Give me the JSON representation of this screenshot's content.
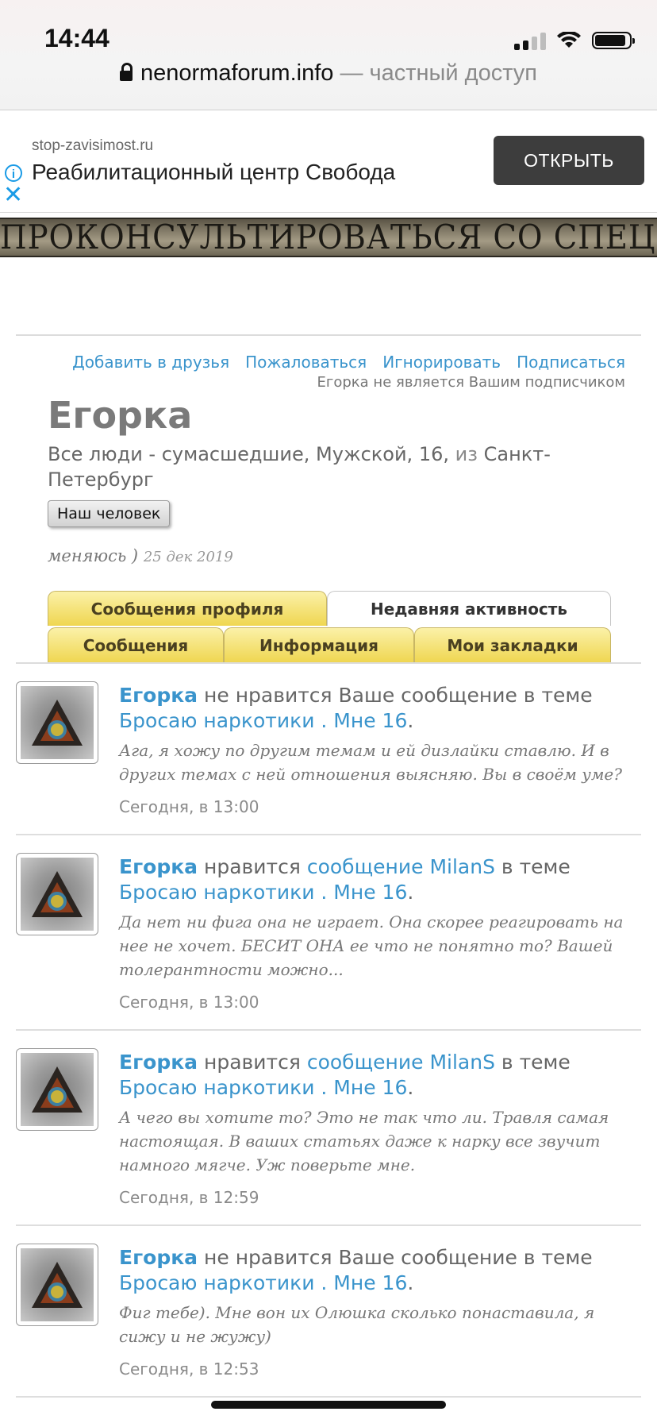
{
  "status_bar": {
    "time": "14:44"
  },
  "browser": {
    "domain": "nenormaforum.info",
    "suffix": "— частный доступ"
  },
  "ad": {
    "domain": "stop-zavisimost.ru",
    "title": "Реабилитационный центр Свобода",
    "button": "ОТКРЫТЬ",
    "info_icon": "i",
    "close_icon": "✕"
  },
  "banner_strip": {
    "text": "ПРОКОНСУЛЬТИРОВАТЬСЯ СО СПЕЦИАЛИСТОМ"
  },
  "profile": {
    "actions": [
      "Добавить в друзья",
      "Пожаловаться",
      "Игнорировать",
      "Подписаться"
    ],
    "subscriber_note": "Егорка не является Вашим подписчиком",
    "name": "Егорка",
    "tagline": "Все люди - сумасшедшие",
    "gender": "Мужской",
    "age": "16",
    "from_word": "из",
    "city": "Санкт-Петербург",
    "rank_badge": "Наш человек",
    "status_text": "меняюсь )",
    "status_date": "25 дек 2019"
  },
  "tabs": {
    "row1": [
      "Сообщения профиля",
      "Недавняя активность"
    ],
    "row2": [
      "Сообщения",
      "Информация",
      "Мои закладки"
    ],
    "active": "Недавняя активность"
  },
  "feed": [
    {
      "user": "Егорка",
      "action": "не нравится Ваше сообщение в теме",
      "thread": "Бросаю наркотики . Мне 16",
      "quote": "Ага, я хожу по другим темам и ей дизлайки ставлю. И в других темах с ней отношения выясняю. Вы в своём уме?",
      "time": "Сегодня, в 13:00"
    },
    {
      "user": "Егорка",
      "action": "нравится",
      "link": "сообщение MilanS",
      "mid": "в теме",
      "thread": "Бросаю наркотики . Мне 16",
      "quote": "Да нет ни фига она не играет. Она скорее реагировать на нее не хочет. БЕСИТ ОНА ее что не понятно то? Вашей толерантности можно...",
      "time": "Сегодня, в 13:00"
    },
    {
      "user": "Егорка",
      "action": "нравится",
      "link": "сообщение MilanS",
      "mid": "в теме",
      "thread": "Бросаю наркотики . Мне 16",
      "quote": "А чего вы хотите то? Это не так что ли. Травля самая настоящая. В ваших статьях даже к нарку все звучит намного мягче. Уж поверьте мне.",
      "time": "Сегодня, в 12:59"
    },
    {
      "user": "Егорка",
      "action": "не нравится Ваше сообщение в теме",
      "thread": "Бросаю наркотики . Мне 16",
      "quote": "Фиг тебе). Мне вон их Олюшка сколько понаставила, я сижу и не жужу)",
      "time": "Сегодня, в 12:53"
    }
  ],
  "colors": {
    "link": "#3a94cc",
    "tab_gold": "#efd651",
    "ad_button": "#3d3d3d"
  }
}
